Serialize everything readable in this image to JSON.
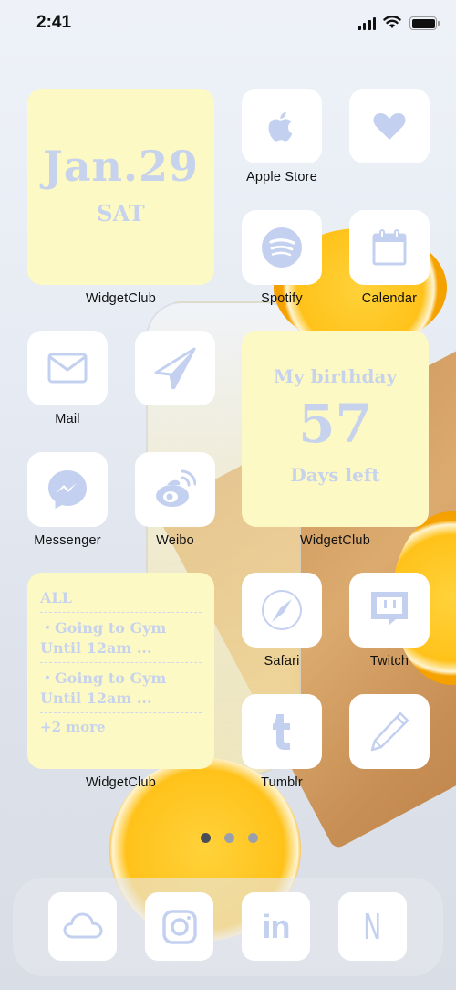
{
  "status_bar": {
    "time": "2:41",
    "signal_icon": "cellular-signal-icon",
    "wifi_icon": "wifi-icon",
    "battery_icon": "battery-icon"
  },
  "colors": {
    "icon_tint": "#c3d0f0",
    "widget_bg": "#fdf9c4",
    "widget_text": "#c7d3ec",
    "tile_bg": "#ffffff",
    "label_text": "#111111"
  },
  "widgets": {
    "date": {
      "label": "WidgetClub",
      "date": "Jan.29",
      "weekday": "SAT"
    },
    "birthday": {
      "label": "WidgetClub",
      "title": "My birthday",
      "days": "57",
      "subtitle": "Days left"
    },
    "todo": {
      "label": "WidgetClub",
      "header": "ALL",
      "items": [
        {
          "text": "・Going to Gym Until 12am ..."
        },
        {
          "text": "・Going to Gym Until 12am ..."
        }
      ],
      "more": "+2 more"
    }
  },
  "apps": [
    {
      "name": "Apple Store",
      "icon": "apple-icon"
    },
    {
      "name": "",
      "icon": "heart-icon"
    },
    {
      "name": "Spotify",
      "icon": "spotify-icon"
    },
    {
      "name": "Calendar",
      "icon": "calendar-icon"
    },
    {
      "name": "Mail",
      "icon": "mail-icon"
    },
    {
      "name": "",
      "icon": "paper-plane-icon"
    },
    {
      "name": "Messenger",
      "icon": "messenger-icon"
    },
    {
      "name": "Weibo",
      "icon": "weibo-icon"
    },
    {
      "name": "Safari",
      "icon": "compass-icon"
    },
    {
      "name": "Twitch",
      "icon": "twitch-icon"
    },
    {
      "name": "Tumblr",
      "icon": "tumblr-icon"
    },
    {
      "name": "",
      "icon": "pencil-icon"
    }
  ],
  "page_indicator": {
    "pages": 3,
    "current": 1
  },
  "dock": [
    {
      "icon": "cloud-icon"
    },
    {
      "icon": "instagram-icon"
    },
    {
      "icon": "linkedin-icon",
      "glyph": "in"
    },
    {
      "icon": "notion-icon",
      "glyph": "N"
    }
  ]
}
